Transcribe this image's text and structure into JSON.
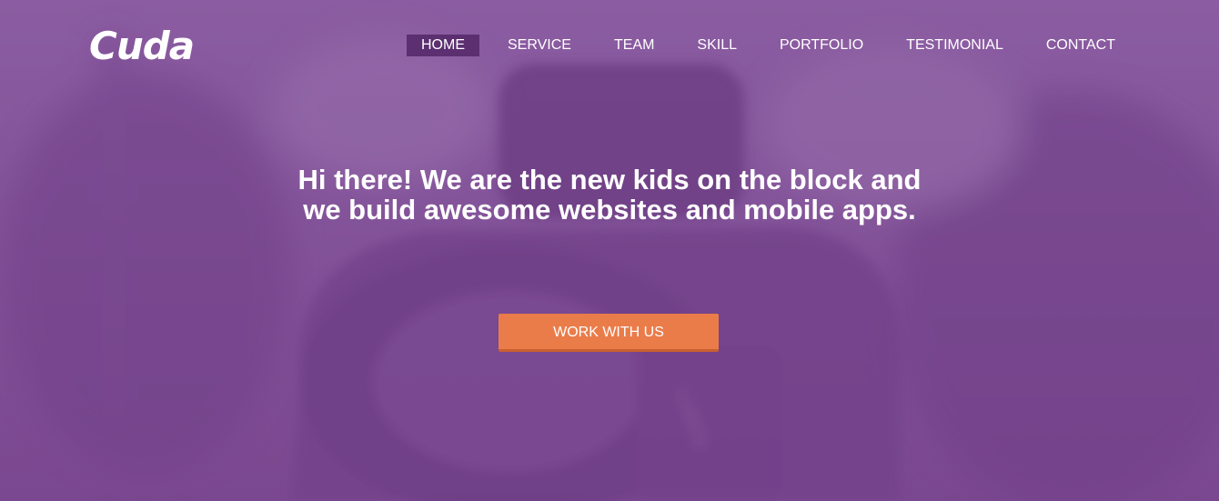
{
  "brand": {
    "logo_text": "Cuda"
  },
  "nav": {
    "items": [
      {
        "label": "HOME",
        "active": true
      },
      {
        "label": "SERVICE",
        "active": false
      },
      {
        "label": "TEAM",
        "active": false
      },
      {
        "label": "SKILL",
        "active": false
      },
      {
        "label": "PORTFOLIO",
        "active": false
      },
      {
        "label": "TESTIMONIAL",
        "active": false
      },
      {
        "label": "CONTACT",
        "active": false
      }
    ]
  },
  "hero": {
    "headline": "Hi there! We are the new kids on the block and we build awesome websites and mobile apps.",
    "cta_label": "WORK WITH US",
    "background_image": "camera-photo",
    "overlay_color": "#7d4b92"
  },
  "colors": {
    "overlay": "#7d4b92",
    "nav_active_bg": "#5b2f70",
    "cta_bg": "#ea7c4a",
    "cta_border": "#c95f30",
    "text": "#ffffff"
  }
}
